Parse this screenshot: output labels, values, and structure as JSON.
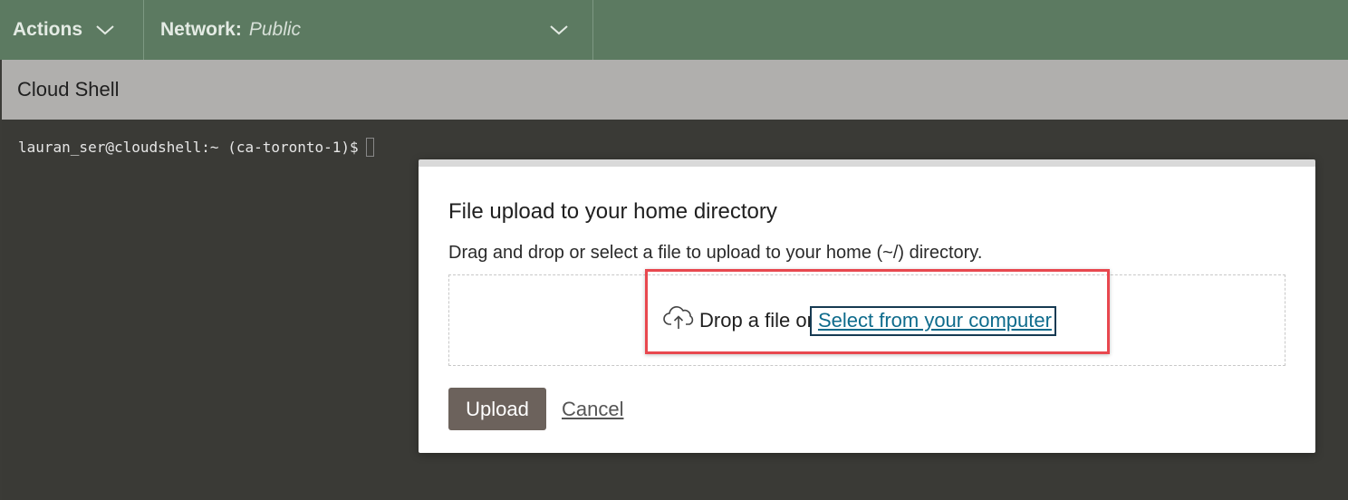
{
  "toolbar": {
    "actions_label": "Actions",
    "network_label": "Network:",
    "network_value": "Public"
  },
  "shell": {
    "title": "Cloud Shell",
    "prompt": "lauran_ser@cloudshell:~ (ca-toronto-1)$"
  },
  "dialog": {
    "title": "File upload to your home directory",
    "description": "Drag and drop or select a file to upload to your home (~/) directory.",
    "drop_text": "Drop a file or",
    "select_link": "Select from your computer",
    "upload_label": "Upload",
    "cancel_label": "Cancel"
  },
  "colors": {
    "toolbar_bg": "#5c7a61",
    "header_bg": "#b0afad",
    "terminal_bg": "#3a3a36",
    "upload_bg": "#6c625c",
    "link": "#0e6b8c",
    "highlight": "#e8484f"
  },
  "icons": {
    "actions_chevron": "chevron-down-icon",
    "network_chevron": "chevron-down-icon",
    "upload_cloud": "cloud-upload-icon"
  }
}
